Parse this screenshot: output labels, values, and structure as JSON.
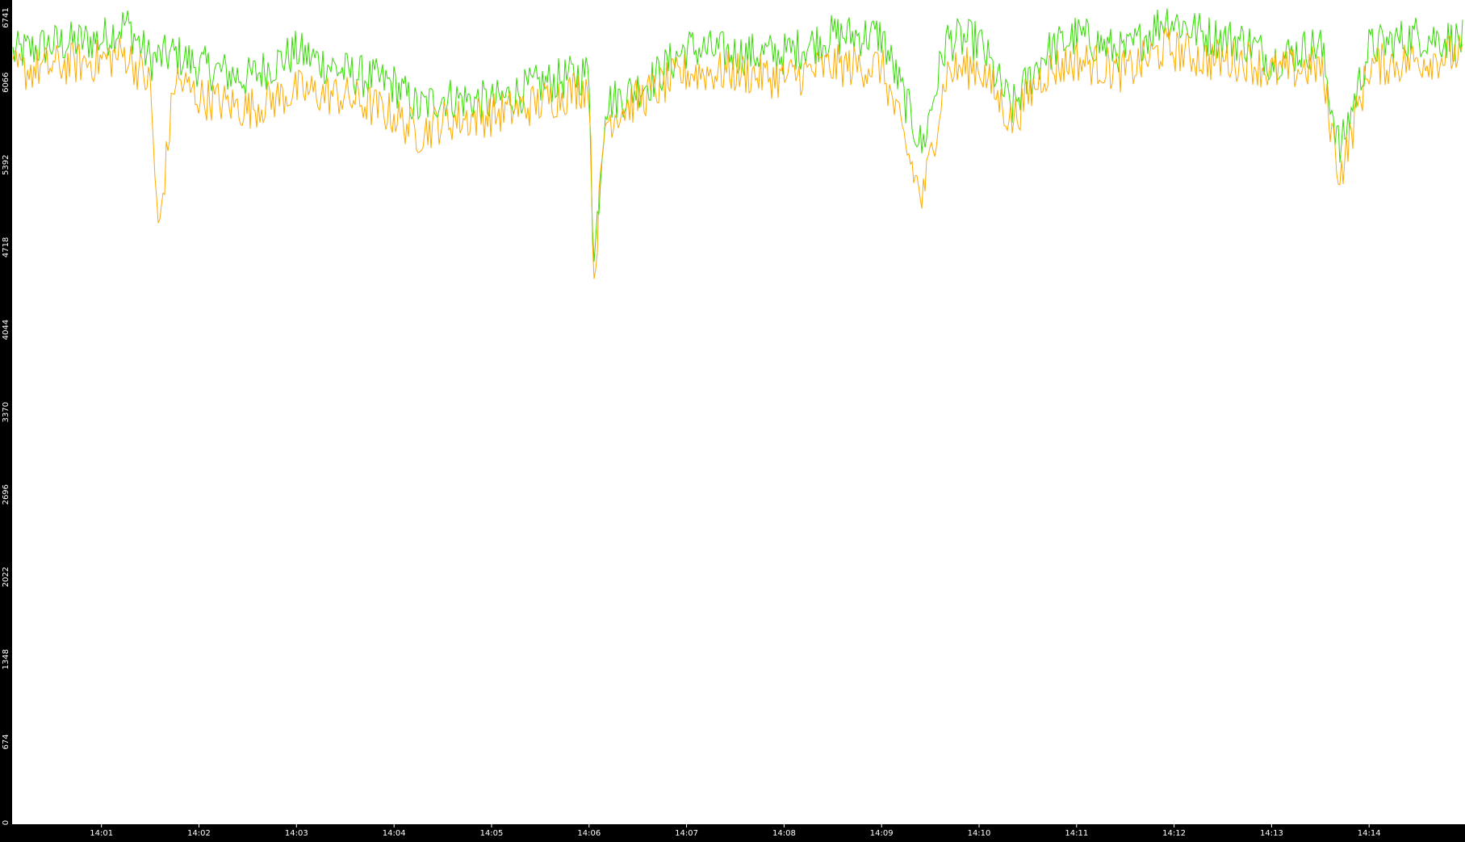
{
  "chart_data": {
    "type": "line",
    "title": "",
    "xlabel": "",
    "ylabel": "",
    "ylim": [
      0,
      6741
    ],
    "grid": false,
    "legend": "none",
    "y_ticks": [
      "0",
      "674",
      "1348",
      "2022",
      "2696",
      "3370",
      "4044",
      "4718",
      "5392",
      "6066",
      "6741"
    ],
    "x_ticks": [
      "14:01",
      "14:02",
      "14:03",
      "14:04",
      "14:05",
      "14:06",
      "14:07",
      "14:08",
      "14:09",
      "14:10",
      "14:11",
      "14:12",
      "14:13",
      "14:14"
    ],
    "x_range": [
      "14:00:05",
      "14:14:59"
    ],
    "series": [
      {
        "color": "#33dd00",
        "x": [
          "14:00:05",
          "14:00:30",
          "14:01:00",
          "14:01:15",
          "14:01:30",
          "14:01:45",
          "14:02:00",
          "14:02:30",
          "14:03:00",
          "14:03:30",
          "14:04:00",
          "14:04:15",
          "14:04:30",
          "14:05:00",
          "14:05:30",
          "14:06:00",
          "14:06:03",
          "14:06:10",
          "14:06:20",
          "14:06:40",
          "14:07:00",
          "14:07:30",
          "14:08:00",
          "14:08:30",
          "14:09:00",
          "14:09:25",
          "14:09:40",
          "14:10:00",
          "14:10:20",
          "14:10:40",
          "14:11:00",
          "14:11:30",
          "14:11:55",
          "14:12:20",
          "14:12:45",
          "14:13:00",
          "14:13:30",
          "14:13:42",
          "14:14:00",
          "14:14:30",
          "14:14:58"
        ],
        "y": [
          6300,
          6380,
          6420,
          6550,
          6250,
          6300,
          6200,
          6100,
          6320,
          6150,
          6050,
          5850,
          5950,
          5900,
          6050,
          6150,
          4550,
          5900,
          5950,
          6100,
          6350,
          6300,
          6300,
          6450,
          6450,
          5530,
          6420,
          6400,
          5850,
          6300,
          6450,
          6300,
          6600,
          6450,
          6400,
          6250,
          6380,
          5500,
          6350,
          6450,
          6400
        ]
      },
      {
        "color": "#ffaa00",
        "x": [
          "14:00:05",
          "14:00:30",
          "14:01:00",
          "14:01:15",
          "14:01:30",
          "14:01:35",
          "14:01:45",
          "14:02:00",
          "14:02:30",
          "14:03:00",
          "14:03:30",
          "14:04:00",
          "14:04:15",
          "14:04:30",
          "14:05:00",
          "14:05:30",
          "14:06:00",
          "14:06:03",
          "14:06:10",
          "14:06:20",
          "14:06:40",
          "14:07:00",
          "14:07:30",
          "14:08:00",
          "14:08:30",
          "14:09:00",
          "14:09:25",
          "14:09:40",
          "14:10:00",
          "14:10:20",
          "14:10:40",
          "14:11:00",
          "14:11:30",
          "14:11:55",
          "14:12:20",
          "14:12:45",
          "14:13:00",
          "14:13:30",
          "14:13:42",
          "14:14:00",
          "14:14:30",
          "14:14:58"
        ],
        "y": [
          6150,
          6200,
          6250,
          6300,
          6050,
          4800,
          6100,
          5950,
          5850,
          6000,
          5950,
          5800,
          5650,
          5750,
          5800,
          5900,
          6050,
          4450,
          5750,
          5850,
          6000,
          6150,
          6150,
          6100,
          6200,
          6200,
          5100,
          6150,
          6200,
          5750,
          6150,
          6250,
          6150,
          6350,
          6250,
          6250,
          6150,
          6200,
          5300,
          6200,
          6250,
          6300
        ]
      }
    ]
  }
}
